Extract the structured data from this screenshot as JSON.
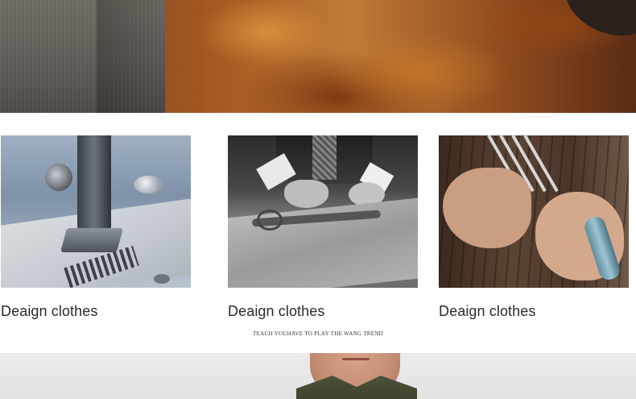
{
  "hero": {
    "image": "tailoring-banner"
  },
  "cards": [
    {
      "label": "Deaign clothes",
      "image": "sewing-machine-photo"
    },
    {
      "label": "Deaign clothes",
      "image": "pattern-cutting-photo"
    },
    {
      "label": "Deaign clothes",
      "image": "hand-needles-photo"
    }
  ],
  "slogan": "TEACH YOUHAVE TO PLAY THE WANG TREND",
  "bottom_banner": {
    "image": "model-portrait"
  }
}
